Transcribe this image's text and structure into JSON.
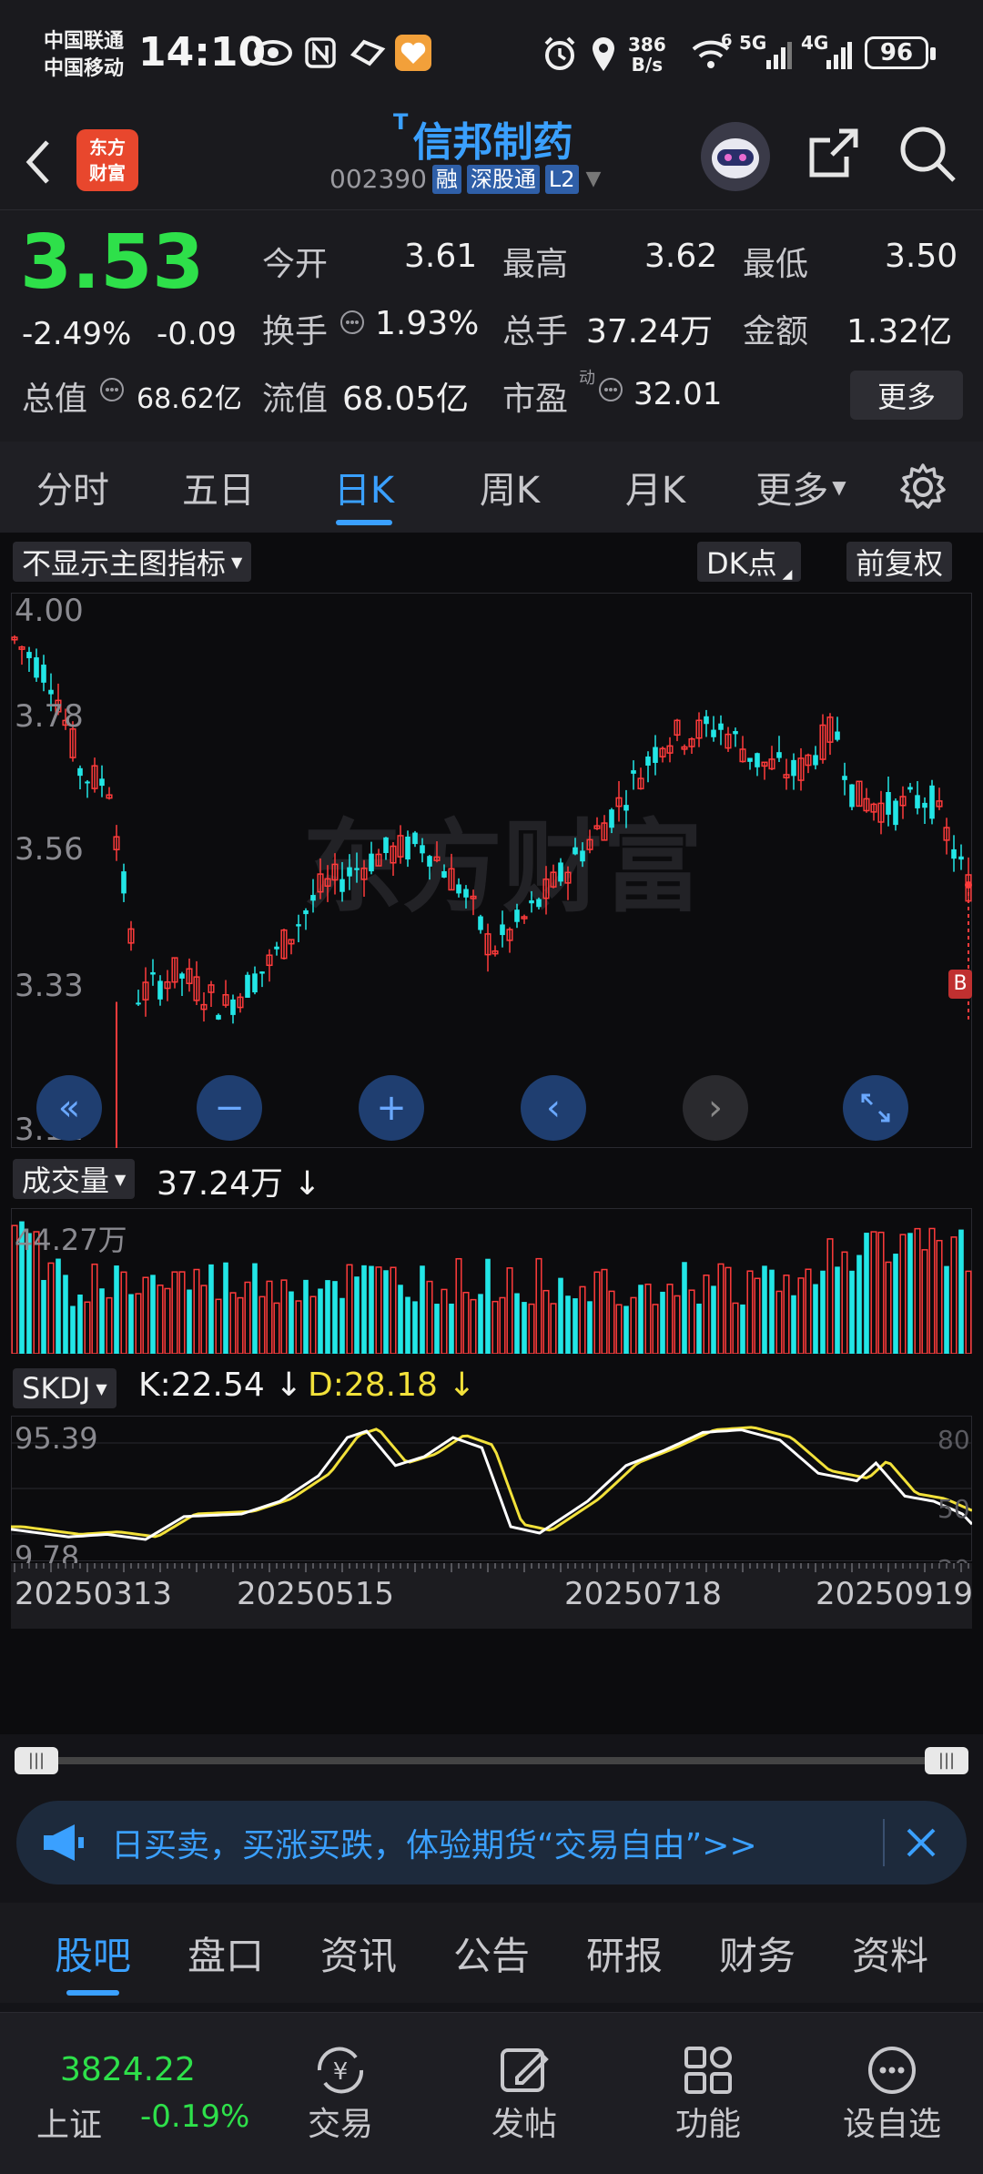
{
  "status_bar": {
    "carrier1": "中国联通",
    "carrier2": "中国移动",
    "time": "14:10",
    "net_speed_value": "386",
    "net_speed_unit": "B/s",
    "wifi_badge": "6",
    "sig1": "5G",
    "sig2": "4G",
    "battery": "96"
  },
  "header": {
    "logo_line1": "东方",
    "logo_line2": "财富",
    "title_prefix": "T",
    "stock_name": "信邦制药",
    "stock_code": "002390",
    "tags": [
      "融",
      "深股通",
      "L2"
    ]
  },
  "quote": {
    "price": "3.53",
    "change_pct": "-2.49%",
    "change": "-0.09",
    "fields": [
      {
        "label": "今开",
        "value": "3.61"
      },
      {
        "label": "最高",
        "value": "3.62"
      },
      {
        "label": "最低",
        "value": "3.50"
      },
      {
        "label": "换手",
        "value": "1.93%"
      },
      {
        "label": "总手",
        "value": "37.24万"
      },
      {
        "label": "金额",
        "value": "1.32亿"
      },
      {
        "label": "总值",
        "value": "68.62亿"
      },
      {
        "label": "流值",
        "value": "68.05亿"
      },
      {
        "label": "市盈",
        "value": "32.01"
      }
    ],
    "pe_superscript": "动",
    "more_label": "更多"
  },
  "period_tabs": [
    "分时",
    "五日",
    "日K",
    "周K",
    "月K",
    "更多"
  ],
  "active_period": "日K",
  "chart": {
    "indicator_selector": "不显示主图指标",
    "dk_label": "DK点",
    "adjust_label": "前复权",
    "price_ticks": [
      "4.00",
      "3.78",
      "3.56",
      "3.33",
      "3.11"
    ],
    "marker_label": "B",
    "watermark": "东方财富",
    "volume_selector": "成交量",
    "volume_value": "37.24万",
    "volume_arrow": "↓",
    "volume_max": "44.27万",
    "skdj_selector": "SKDJ",
    "skdj_k": "K:22.54",
    "skdj_k_arrow": "↓",
    "skdj_d": "D:28.18",
    "skdj_d_arrow": "↓",
    "skdj_left_ticks": [
      "95.39",
      "9.78"
    ],
    "skdj_right_ticks": [
      "80",
      "50",
      "20"
    ],
    "date_labels": [
      "20250313",
      "20250515",
      "20250718",
      "20250919"
    ],
    "colors": {
      "up": "#ff3b3b",
      "down": "#22e6e6",
      "k_line": "#ffffff",
      "d_line": "#f2e13a"
    }
  },
  "promo": {
    "text": "日买卖，买涨买跌，体验期货“交易自由”>>"
  },
  "bottom_tabs": [
    "股吧",
    "盘口",
    "资讯",
    "公告",
    "研报",
    "财务",
    "资料"
  ],
  "active_bottom_tab": "股吧",
  "bottom_nav": {
    "index_value": "3824.22",
    "index_name": "上证",
    "index_change": "-0.19%",
    "items": [
      {
        "label": "交易",
        "icon": "yen-exchange-icon"
      },
      {
        "label": "发帖",
        "icon": "edit-icon"
      },
      {
        "label": "功能",
        "icon": "grid-icon"
      },
      {
        "label": "设自选",
        "icon": "chat-dots-icon"
      }
    ]
  }
}
